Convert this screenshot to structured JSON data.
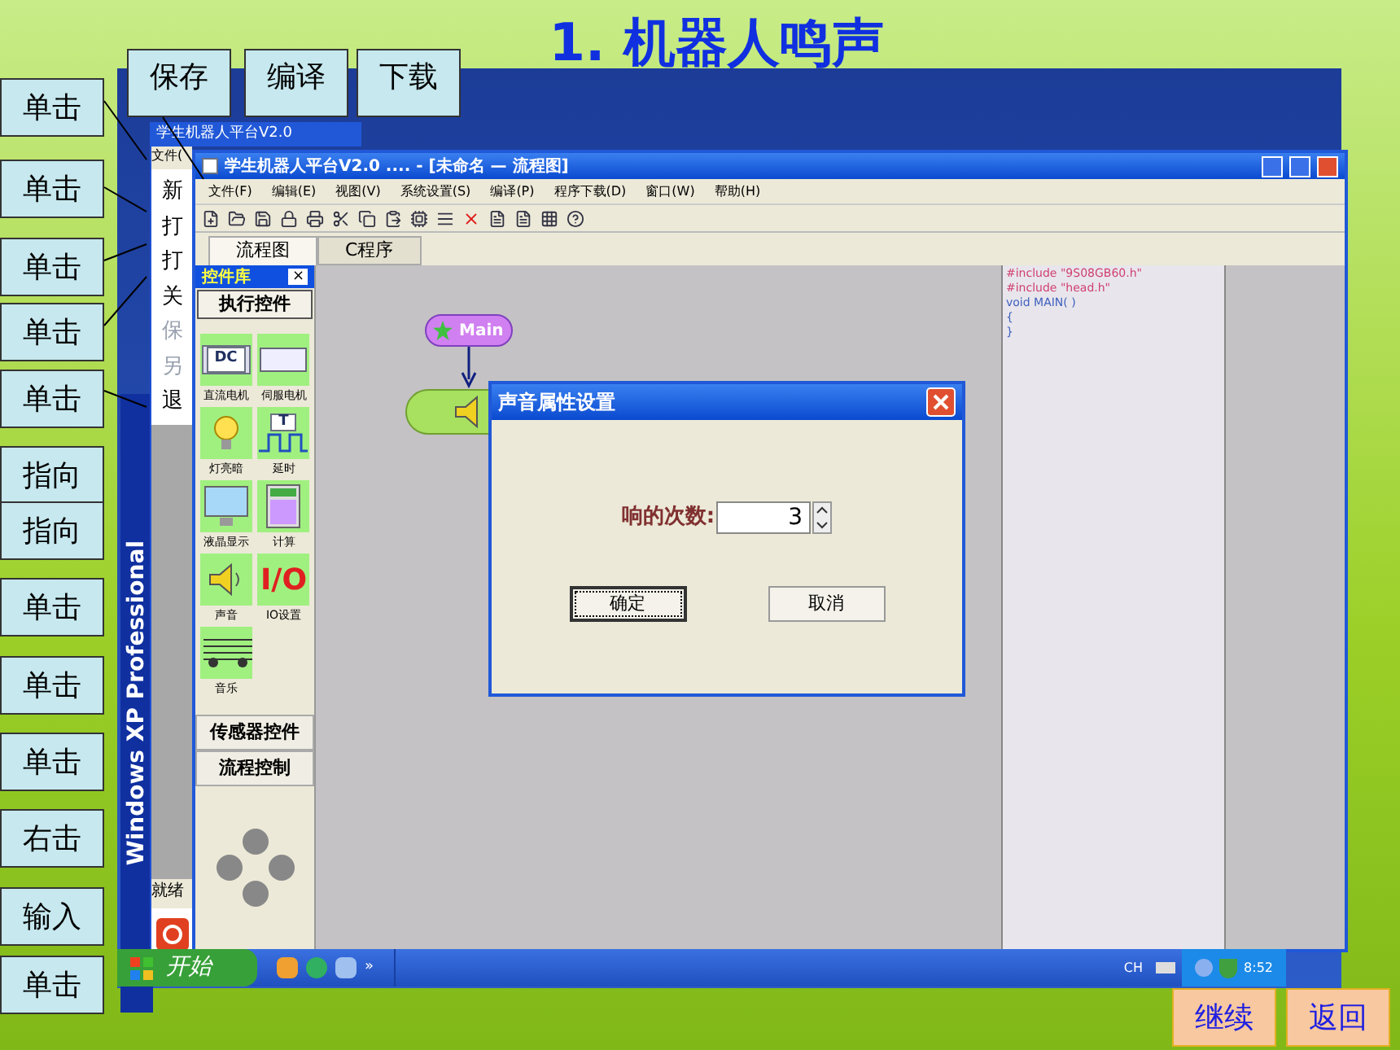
{
  "slide_title": "1. 机器人鸣声",
  "top_labels": [
    "保存",
    "编译",
    "下载"
  ],
  "side_labels": [
    "单击",
    "单击",
    "单击",
    "单击",
    "单击",
    "指向",
    "指向",
    "单击",
    "单击",
    "单击",
    "右击",
    "输入",
    "单击"
  ],
  "back_window": {
    "title": "学生机器人平台V2.0",
    "menu": "文件(",
    "items": [
      "新",
      "打",
      "打",
      "关",
      "保",
      "另",
      "退"
    ],
    "status": "就绪"
  },
  "desktop_banner": "Windows XP Professional",
  "window": {
    "title": "学生机器人平台V2.0 .... - [未命名 — 流程图]",
    "menu": [
      "文件(F)",
      "编辑(E)",
      "视图(V)",
      "系统设置(S)",
      "编译(P)",
      "程序下载(D)",
      "窗口(W)",
      "帮助(H)"
    ],
    "tabs": [
      {
        "label": "流程图",
        "selected": true
      },
      {
        "label": "C程序",
        "selected": false
      }
    ],
    "palette": {
      "title": "控件库",
      "close": "×",
      "group": "执行控件",
      "items": [
        {
          "label": "直流电机"
        },
        {
          "label": "伺服电机"
        },
        {
          "label": "灯亮暗"
        },
        {
          "label": "延时"
        },
        {
          "label": "液晶显示"
        },
        {
          "label": "计算"
        },
        {
          "label": "声音"
        },
        {
          "label": "IO设置"
        },
        {
          "label": "音乐"
        }
      ],
      "icon_glyphs": [
        "DC",
        "T",
        "I/O"
      ],
      "groups": [
        "传感器控件",
        "流程控制"
      ]
    },
    "canvas": {
      "start_node": "Main"
    },
    "code": [
      "#include \"9S08GB60.h\"",
      "#include \"head.h\"",
      "void MAIN( )",
      "{",
      "}"
    ]
  },
  "dialog": {
    "title": "声音属性设置",
    "field_label": "响的次数:",
    "value": "3",
    "buttons": [
      {
        "label": "确定",
        "focused": true
      },
      {
        "label": "取消",
        "focused": false
      }
    ]
  },
  "taskbar": {
    "start": "开始",
    "more": "»",
    "language": "CH",
    "clock": "8:52"
  },
  "nav_buttons": [
    "继续",
    "返回"
  ]
}
